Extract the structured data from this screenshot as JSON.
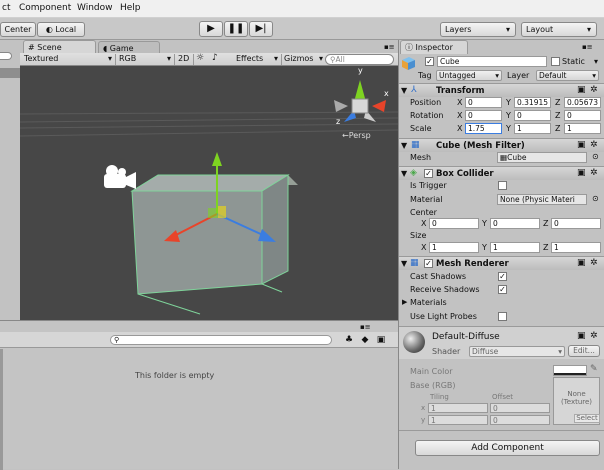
{
  "menu": [
    "ct",
    "Component",
    "Window",
    "Help"
  ],
  "toolbar": {
    "center": "Center",
    "local": "Local",
    "layers": "Layers",
    "layout": "Layout"
  },
  "tabs": {
    "scene": "Scene",
    "game": "Game",
    "inspector": "Inspector"
  },
  "scene_bar": {
    "shading": "Textured",
    "rendering": "RGB",
    "mode2d": "2D",
    "effects": "Effects",
    "gizmos": "Gizmos",
    "search": "All"
  },
  "gizmo": {
    "y": "y",
    "x": "x",
    "z": "z",
    "persp": "←Persp"
  },
  "project": {
    "empty": "This folder is empty"
  },
  "inspector": {
    "name": "Cube",
    "static": "Static",
    "tag_label": "Tag",
    "tag": "Untagged",
    "layer_label": "Layer",
    "layer": "Default",
    "transform": {
      "title": "Transform",
      "position_label": "Position",
      "position": [
        "0",
        "0.31915",
        "0.05673"
      ],
      "rotation_label": "Rotation",
      "rotation": [
        "0",
        "0",
        "0"
      ],
      "scale_label": "Scale",
      "scale": [
        "1.75",
        "1",
        "1"
      ],
      "x": "X",
      "y": "Y",
      "z": "Z"
    },
    "mesh_filter": {
      "title": "Cube (Mesh Filter)",
      "mesh_label": "Mesh",
      "mesh": "Cube"
    },
    "box_collider": {
      "title": "Box Collider",
      "trigger_label": "Is Trigger",
      "material_label": "Material",
      "material": "None (Physic Materi",
      "center_label": "Center",
      "center": [
        "0",
        "0",
        "0"
      ],
      "size_label": "Size",
      "size": [
        "1",
        "1",
        "1"
      ]
    },
    "mesh_renderer": {
      "title": "Mesh Renderer",
      "cast_label": "Cast Shadows",
      "receive_label": "Receive Shadows",
      "materials_label": "Materials",
      "probes_label": "Use Light Probes"
    },
    "material": {
      "name": "Default-Diffuse",
      "shader_label": "Shader",
      "shader": "Diffuse",
      "edit": "Edit...",
      "main_color": "Main Color",
      "base": "Base (RGB)",
      "none_texture": "None\n(Texture)",
      "tiling": "Tiling",
      "offset": "Offset",
      "tiling_x": "1",
      "tiling_y": "1",
      "offset_x": "0",
      "offset_y": "0",
      "select": "Select"
    },
    "add_component": "Add Component"
  }
}
